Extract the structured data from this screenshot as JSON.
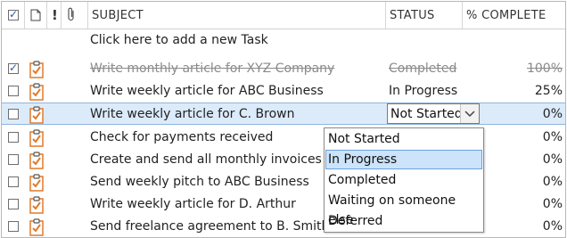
{
  "header": {
    "subject_label": "SUBJECT",
    "status_label": "STATUS",
    "complete_label": "% COMPLETE",
    "icons": [
      "checkbox-icon",
      "document-icon",
      "importance-icon",
      "attachment-icon"
    ]
  },
  "new_task_prompt": "Click here to add a new Task",
  "tasks": [
    {
      "subject": "Write monthly article for XYZ Company",
      "status": "Completed",
      "complete": "100%",
      "checked": true
    },
    {
      "subject": "Write weekly article for ABC Business",
      "status": "In Progress",
      "complete": "25%",
      "checked": false
    },
    {
      "subject": "Write weekly article for C. Brown",
      "status": "Not Started",
      "complete": "0%",
      "checked": false
    },
    {
      "subject": "Check for payments received",
      "status": "",
      "complete": "0%",
      "checked": false
    },
    {
      "subject": "Create and send all monthly invoices",
      "status": "",
      "complete": "0%",
      "checked": false
    },
    {
      "subject": "Send weekly pitch to ABC Business",
      "status": "",
      "complete": "0%",
      "checked": false
    },
    {
      "subject": "Write weekly article for D. Arthur",
      "status": "",
      "complete": "0%",
      "checked": false
    },
    {
      "subject": "Send freelance agreement to B. Smith",
      "status": "",
      "complete": "0%",
      "checked": false
    }
  ],
  "status_dropdown": {
    "selected": "Not Started",
    "options": [
      "Not Started",
      "In Progress",
      "Completed",
      "Waiting on someone else",
      "Deferred"
    ],
    "highlighted": "In Progress"
  },
  "colors": {
    "selection_row": "#dcebfa",
    "highlight_option": "#cce3f9",
    "task_icon_orange": "#e07a2a",
    "check_blue": "#2a5aa8"
  }
}
